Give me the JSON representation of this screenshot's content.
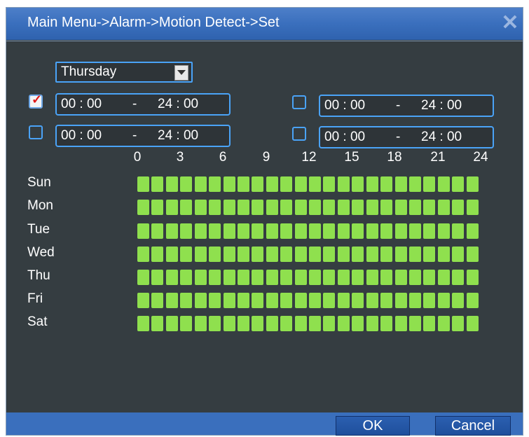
{
  "window": {
    "title": "Main Menu->Alarm->Motion Detect->Set",
    "close_icon": "close-icon"
  },
  "day_select": {
    "value": "Thursday"
  },
  "periods": [
    {
      "checked": true,
      "start": "00 : 00",
      "sep": "-",
      "end": "24 : 00"
    },
    {
      "checked": false,
      "start": "00 : 00",
      "sep": "-",
      "end": "24 : 00"
    },
    {
      "checked": false,
      "start": "00 : 00",
      "sep": "-",
      "end": "24 : 00"
    },
    {
      "checked": false,
      "start": "00 : 00",
      "sep": "-",
      "end": "24 : 00"
    }
  ],
  "timeline": {
    "hour_labels": [
      "0",
      "3",
      "6",
      "9",
      "12",
      "15",
      "18",
      "21",
      "24"
    ],
    "days": [
      "Sun",
      "Mon",
      "Tue",
      "Wed",
      "Thu",
      "Fri",
      "Sat"
    ],
    "active_hours_per_day": 24,
    "active_color": "#8fe04e"
  },
  "footer": {
    "ok_label": "OK",
    "cancel_label": "Cancel"
  },
  "colors": {
    "titlebar": "#3a6fbd",
    "panel": "#353d41",
    "accent": "#4aa3f7"
  }
}
